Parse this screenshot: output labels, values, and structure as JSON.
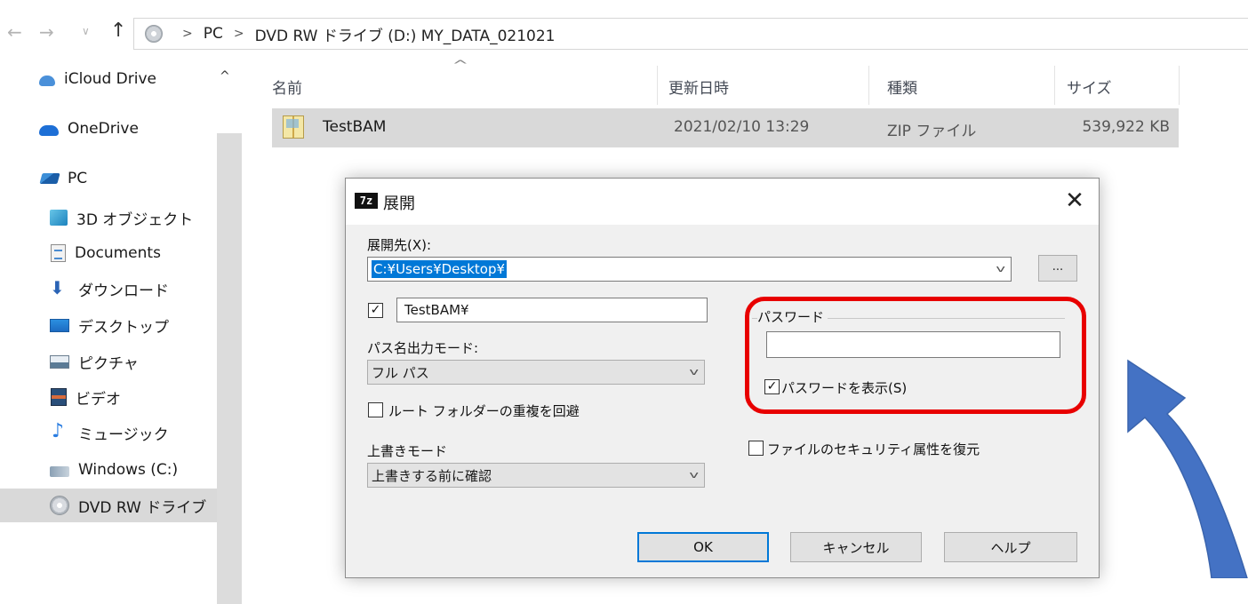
{
  "explorer": {
    "nav": {
      "back": "←",
      "forward": "→",
      "recent": "∨",
      "up": "↑"
    },
    "breadcrumb": {
      "sep": ">",
      "items": [
        "PC",
        "DVD RW ドライブ (D:) MY_DATA_021021"
      ]
    },
    "sidebar": {
      "items": [
        {
          "label": "iCloud Drive",
          "icon": "icloud-icon"
        },
        {
          "label": "OneDrive",
          "icon": "onedrive-icon"
        },
        {
          "label": "PC",
          "icon": "pc-icon"
        },
        {
          "label": "3D オブジェクト",
          "icon": "3d-objects-icon"
        },
        {
          "label": "Documents",
          "icon": "documents-icon"
        },
        {
          "label": "ダウンロード",
          "icon": "downloads-icon"
        },
        {
          "label": "デスクトップ",
          "icon": "desktop-icon"
        },
        {
          "label": "ピクチャ",
          "icon": "pictures-icon"
        },
        {
          "label": "ビデオ",
          "icon": "videos-icon"
        },
        {
          "label": "ミュージック",
          "icon": "music-icon"
        },
        {
          "label": "Windows (C:)",
          "icon": "windows-drive-icon"
        },
        {
          "label": "DVD RW ドライブ",
          "icon": "dvd-drive-icon"
        }
      ],
      "selected": "DVD RW ドライブ",
      "collapse_caret": "^"
    },
    "columns": {
      "name": "名前",
      "modified": "更新日時",
      "type": "種類",
      "size": "サイズ",
      "sort_indicator": "^"
    },
    "files": [
      {
        "name": "TestBAM",
        "modified": "2021/02/10 13:29",
        "type": "ZIP ファイル",
        "size": "539,922 KB"
      }
    ]
  },
  "dialog": {
    "app_icon": "7z",
    "title": "展開",
    "close": "✕",
    "extract_to": {
      "label": "展開先(X):",
      "value": "C:¥Users¥Desktop¥",
      "browse": "..."
    },
    "subfolder": {
      "checked": true,
      "check_mark": "✓",
      "value": "TestBAM¥"
    },
    "path_mode": {
      "label": "パス名出力モード:",
      "value": "フル パス"
    },
    "eliminate_dup": {
      "checked": false,
      "label": "ルート フォルダーの重複を回避"
    },
    "overwrite": {
      "label": "上書きモード",
      "value": "上書きする前に確認"
    },
    "password": {
      "label": "パスワード",
      "value": "",
      "show": {
        "checked": true,
        "check_mark": "✓",
        "label": "パスワードを表示(S)"
      }
    },
    "restore_security": {
      "checked": false,
      "label": "ファイルのセキュリティ属性を復元"
    },
    "buttons": {
      "ok": "OK",
      "cancel": "キャンセル",
      "help": "ヘルプ"
    }
  },
  "annotation": {
    "highlight_color": "#e80000",
    "arrow_color": "#4472c4"
  }
}
